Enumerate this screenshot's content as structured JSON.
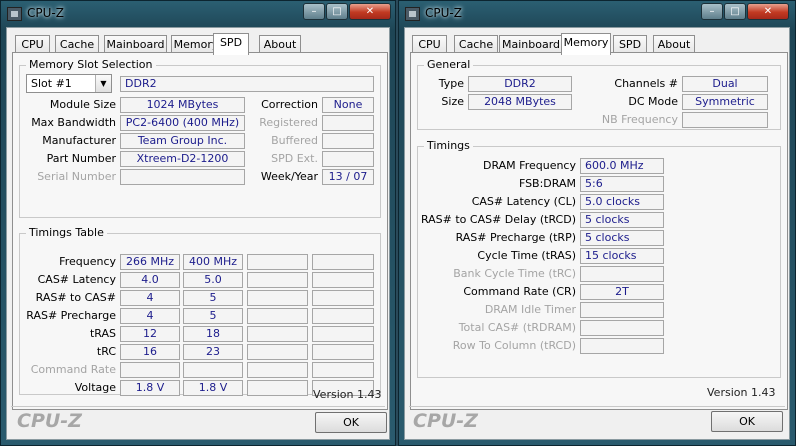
{
  "w1": {
    "title": "CPU-Z",
    "buttons": {
      "min": "–",
      "max": "□",
      "close": "✕"
    },
    "tabs": [
      "CPU",
      "Cache",
      "Mainboard",
      "Memory",
      "SPD",
      "About"
    ],
    "active_tab": "SPD",
    "slot": {
      "group_title": "Memory Slot Selection",
      "selected": "Slot #1",
      "type": "DDR2",
      "module_size_label": "Module Size",
      "module_size": "1024 MBytes",
      "max_bw_label": "Max Bandwidth",
      "max_bw": "PC2-6400 (400 MHz)",
      "manufacturer_label": "Manufacturer",
      "manufacturer": "Team Group Inc.",
      "part_label": "Part Number",
      "part": "Xtreem-D2-1200",
      "serial_label": "Serial Number",
      "serial": "",
      "correction_label": "Correction",
      "correction": "None",
      "registered_label": "Registered",
      "registered": "",
      "buffered_label": "Buffered",
      "buffered": "",
      "spd_ext_label": "SPD Ext.",
      "spd_ext": "",
      "week_year_label": "Week/Year",
      "week_year": "13 / 07"
    },
    "timings": {
      "group_title": "Timings Table",
      "rows": [
        {
          "label": "Frequency",
          "v1": "266 MHz",
          "v2": "400 MHz",
          "dim": false
        },
        {
          "label": "CAS# Latency",
          "v1": "4.0",
          "v2": "5.0",
          "dim": false
        },
        {
          "label": "RAS# to CAS#",
          "v1": "4",
          "v2": "5",
          "dim": false
        },
        {
          "label": "RAS# Precharge",
          "v1": "4",
          "v2": "5",
          "dim": false
        },
        {
          "label": "tRAS",
          "v1": "12",
          "v2": "18",
          "dim": false
        },
        {
          "label": "tRC",
          "v1": "16",
          "v2": "23",
          "dim": false
        },
        {
          "label": "Command Rate",
          "v1": "",
          "v2": "",
          "dim": true
        },
        {
          "label": "Voltage",
          "v1": "1.8 V",
          "v2": "1.8 V",
          "dim": false
        }
      ]
    },
    "version": "Version 1.43",
    "brand": "CPU-Z",
    "ok": "OK"
  },
  "w2": {
    "title": "CPU-Z",
    "buttons": {
      "min": "–",
      "max": "□",
      "close": "✕"
    },
    "tabs": [
      "CPU",
      "Cache",
      "Mainboard",
      "Memory",
      "SPD",
      "About"
    ],
    "active_tab": "Memory",
    "general": {
      "group_title": "General",
      "type_label": "Type",
      "type": "DDR2",
      "size_label": "Size",
      "size": "2048 MBytes",
      "channels_label": "Channels #",
      "channels": "Dual",
      "dc_mode_label": "DC Mode",
      "dc_mode": "Symmetric",
      "nb_freq_label": "NB Frequency",
      "nb_freq": ""
    },
    "timings": {
      "group_title": "Timings",
      "rows": [
        {
          "label": "DRAM Frequency",
          "value": "600.0 MHz",
          "dim": false
        },
        {
          "label": "FSB:DRAM",
          "value": "5:6",
          "dim": false
        },
        {
          "label": "CAS# Latency (CL)",
          "value": "5.0 clocks",
          "dim": false
        },
        {
          "label": "RAS# to CAS# Delay (tRCD)",
          "value": "5 clocks",
          "dim": false
        },
        {
          "label": "RAS# Precharge (tRP)",
          "value": "5 clocks",
          "dim": false
        },
        {
          "label": "Cycle Time (tRAS)",
          "value": "15 clocks",
          "dim": false
        },
        {
          "label": "Bank Cycle Time (tRC)",
          "value": "",
          "dim": true
        },
        {
          "label": "Command Rate (CR)",
          "value": "2T",
          "dim": false
        },
        {
          "label": "DRAM Idle Timer",
          "value": "",
          "dim": true
        },
        {
          "label": "Total CAS# (tRDRAM)",
          "value": "",
          "dim": true
        },
        {
          "label": "Row To Column (tRCD)",
          "value": "",
          "dim": true
        }
      ]
    },
    "version": "Version 1.43",
    "brand": "CPU-Z",
    "ok": "OK"
  }
}
